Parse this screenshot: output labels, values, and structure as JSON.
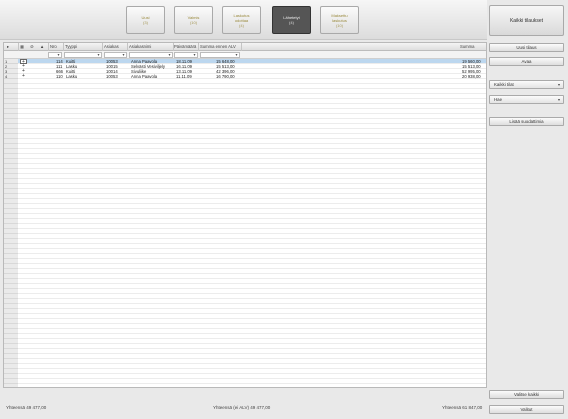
{
  "tiles": [
    {
      "label": "Uusi",
      "count": "(3)",
      "active": false
    },
    {
      "label": "Valmis",
      "count": "(10)",
      "active": false
    },
    {
      "label": "Laskutus\nodottaa",
      "count": "(4)",
      "active": false
    },
    {
      "label": "Lähetetyt",
      "count": "(4)",
      "active": true
    },
    {
      "label": "Maksettu\nlaskutus",
      "count": "(10)",
      "active": false
    }
  ],
  "all_orders_label": "Kaikki tilaukset",
  "grid": {
    "headers": [
      "Nro",
      "Tyyppi",
      "Asiakas",
      "Asiakasnimi",
      "Päivämäärä",
      "Summa ennen ALV",
      "Summa"
    ],
    "rows": [
      {
        "idx": "1",
        "no": "114",
        "type": "Kuitti",
        "cust": "10053",
        "name": "Anna Paavola",
        "date": "18.11.09",
        "net": "15 648,00",
        "total": "19 560,00",
        "selected": true
      },
      {
        "idx": "2",
        "no": "111",
        "type": "Lasku",
        "cust": "10015",
        "name": "Selvästi Vesiviljely",
        "date": "16.11.09",
        "net": "15 513,00",
        "total": "15 513,00",
        "selected": false
      },
      {
        "idx": "3",
        "no": "666",
        "type": "Kuitti",
        "cust": "10014",
        "name": "Sivuliike",
        "date": "13.11.09",
        "net": "42 396,00",
        "total": "52 995,00",
        "selected": false
      },
      {
        "idx": "4",
        "no": "110",
        "type": "Lasku",
        "cust": "10053",
        "name": "Anna Paavola",
        "date": "11.11.09",
        "net": "16 790,00",
        "total": "20 938,00",
        "selected": false
      }
    ]
  },
  "right_panel": {
    "new_order": "Uusi tilaus",
    "open": "Avaa",
    "dropdown1": "Kaikki tilat",
    "dropdown2": "Hae",
    "filter_btn": "Lisää suodattimia",
    "select_all": "Valitse kaikki",
    "selected_label": "Valitut"
  },
  "footer": {
    "left": "Yhteensä 49 477,00",
    "middle": "Yhteensä (ei ALV) 49 477,00",
    "right": "Yhteensä 61 847,00"
  }
}
